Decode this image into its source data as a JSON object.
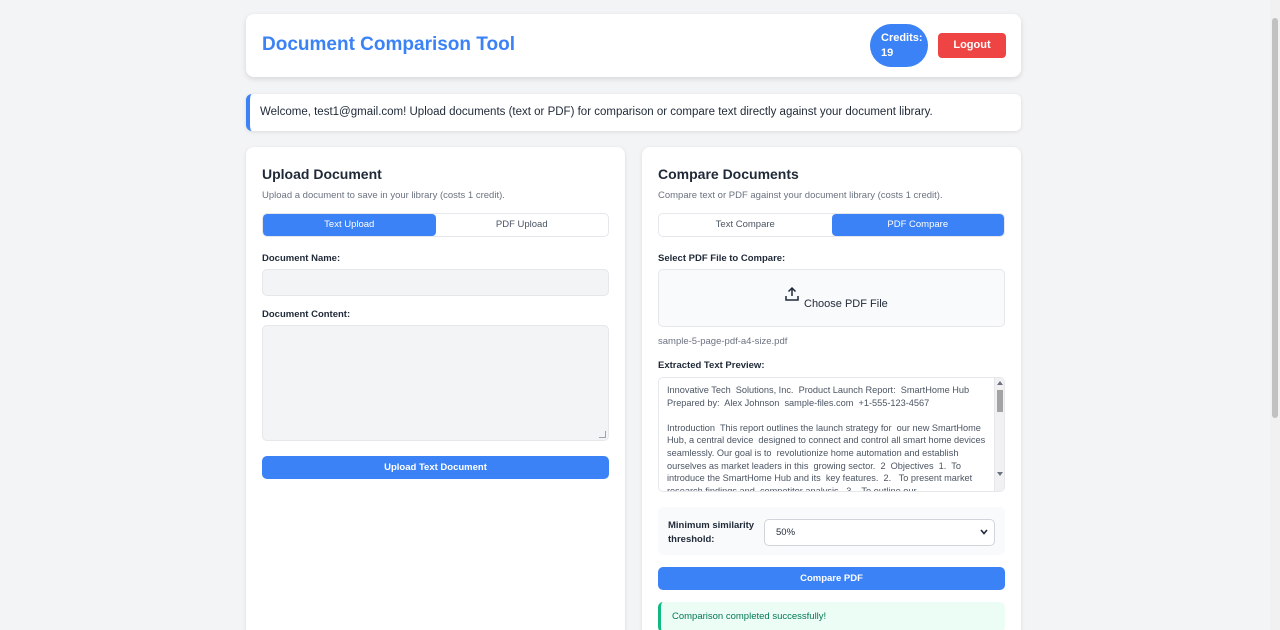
{
  "header": {
    "title": "Document Comparison Tool",
    "credits_label": "Credits:",
    "credits_value": "19",
    "logout_label": "Logout"
  },
  "welcome": {
    "message": "Welcome, test1@gmail.com! Upload documents (text or PDF) for comparison or compare text directly against your document library."
  },
  "upload": {
    "title": "Upload Document",
    "subtitle": "Upload a document to save in your library (costs 1 credit).",
    "tabs": [
      {
        "label": "Text Upload",
        "active": true
      },
      {
        "label": "PDF Upload",
        "active": false
      }
    ],
    "name_label": "Document Name:",
    "name_value": "",
    "content_label": "Document Content:",
    "content_value": "",
    "submit_label": "Upload Text Document"
  },
  "compare": {
    "title": "Compare Documents",
    "subtitle": "Compare text or PDF against your document library (costs 1 credit).",
    "tabs": [
      {
        "label": "Text Compare",
        "active": false
      },
      {
        "label": "PDF Compare",
        "active": true
      }
    ],
    "file_label": "Select PDF File to Compare:",
    "choose_label": "Choose PDF File",
    "filename": "sample-5-page-pdf-a4-size.pdf",
    "preview_label": "Extracted Text Preview:",
    "preview_text": "Innovative Tech  Solutions, Inc.  Product Launch Report:  SmartHome Hub\nPrepared by:  Alex Johnson  sample-files.com  +1-555-123-4567\n\nIntroduction  This report outlines the launch strategy for  our new SmartHome Hub, a central device  designed to connect and control all smart home devices seamlessly. Our goal is to  revolutionize home automation and establish ourselves as market leaders in this  growing sector.  2  Objectives  1.  To introduce the SmartHome Hub and its  key features.  2.   To present market research findings and  competitor analysis.  3.   To outline our",
    "threshold_label": "Minimum similarity threshold:",
    "threshold_value": "50%",
    "submit_label": "Compare PDF",
    "success_message": "Comparison completed successfully!"
  },
  "colors": {
    "accent": "#3b82f6",
    "danger": "#ef4444",
    "success": "#10b981"
  }
}
